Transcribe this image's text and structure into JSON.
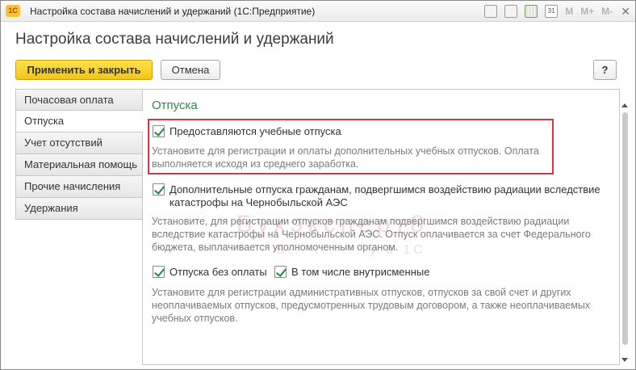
{
  "window": {
    "logo_text": "1С",
    "title": "Настройка состава начислений и удержаний  (1С:Предприятие)",
    "toolbar": {
      "m_label": "M",
      "m_plus_label": "M+",
      "m_minus_label": "M-",
      "calendar_day": "31",
      "close_glyph": "✕"
    }
  },
  "form": {
    "title": "Настройка состава начислений и удержаний",
    "apply_close_label": "Применить и закрыть",
    "cancel_label": "Отмена",
    "help_label": "?"
  },
  "tabs": [
    {
      "label": "Почасовая оплата",
      "active": false
    },
    {
      "label": "Отпуска",
      "active": true
    },
    {
      "label": "Учет отсутствий",
      "active": false
    },
    {
      "label": "Материальная помощь",
      "active": false
    },
    {
      "label": "Прочие начисления",
      "active": false
    },
    {
      "label": "Удержания",
      "active": false
    }
  ],
  "section": {
    "title": "Отпуска",
    "study_leave": {
      "checked": true,
      "label": "Предоставляются учебные отпуска",
      "hint_line1": "Установите для регистрации и оплаты дополнительных учебных отпусков. Оплата",
      "hint_line2": "выполняется исходя из среднего заработка."
    },
    "chernobyl_leave": {
      "checked": true,
      "label_line1": "Дополнительные отпуска гражданам, подвергшимся воздействию радиации вследствие",
      "label_line2": "катастрофы на Чернобыльской АЭС",
      "hint_line1": "Установите, для регистрации отпусков гражданам подвергшимся воздействию радиации",
      "hint_line2": "вследствие катастрофы на Чернобыльской АЭС. Отпуск оплачивается за счет Федерального",
      "hint_line3": "бюджета, выплачивается уполномоченным органом."
    },
    "unpaid_leave": {
      "checked": true,
      "label": "Отпуска без оплаты"
    },
    "intra_shift": {
      "checked": true,
      "label": "В том числе внутрисменные"
    },
    "unpaid_hint": {
      "line1": "Установите для регистрации административных отпусков, отпусков за свой счет и других",
      "line2": "неоплачиваемых отпусков, предусмотренных трудовым договором, а также неоплачиваемых",
      "line3": "учебных отпусков."
    }
  },
  "watermark": {
    "main": "Бухэксперт8",
    "sub": "Б... ... ... у в 1С"
  },
  "colors": {
    "primary_button": "#f3c613",
    "section_title": "#2f8c4a",
    "highlight_border": "#d9363e",
    "check_mark": "#1d8c3a"
  }
}
